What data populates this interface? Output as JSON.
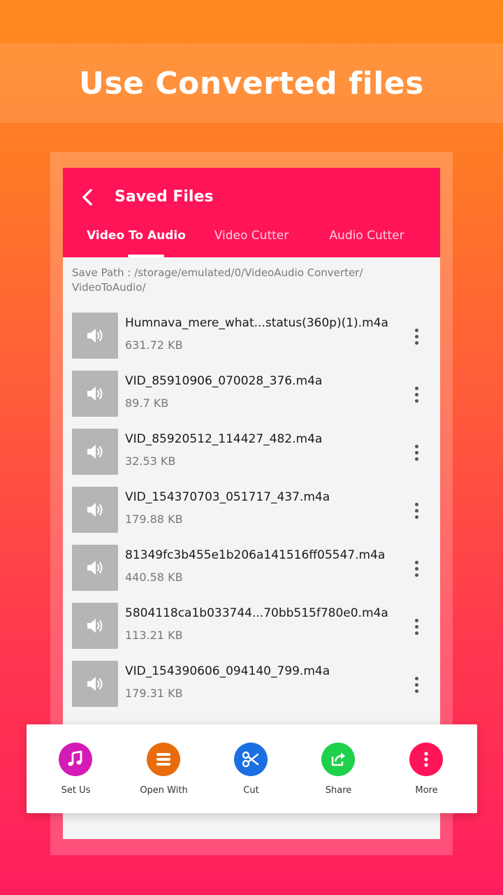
{
  "promo": {
    "title": "Use Converted files"
  },
  "header": {
    "title": "Saved Files",
    "back_icon": "back-arrow-icon"
  },
  "tabs": [
    {
      "label": "Video To Audio",
      "active": true
    },
    {
      "label": "Video Cutter",
      "active": false
    },
    {
      "label": "Audio Cutter",
      "active": false
    }
  ],
  "save_path": "Save Path : /storage/emulated/0/VideoAudio Converter/\nVideoToAudio/",
  "files": [
    {
      "name": "Humnava_mere_what...status(360p)(1).m4a",
      "size": "631.72 KB"
    },
    {
      "name": "VID_85910906_070028_376.m4a",
      "size": "89.7 KB"
    },
    {
      "name": "VID_85920512_114427_482.m4a",
      "size": "32.53 KB"
    },
    {
      "name": "VID_154370703_051717_437.m4a",
      "size": "179.88 KB"
    },
    {
      "name": "81349fc3b455e1b206a141516ff05547.m4a",
      "size": "440.58 KB"
    },
    {
      "name": "5804118ca1b033744...70bb515f780e0.m4a",
      "size": "113.21 KB"
    },
    {
      "name": "VID_154390606_094140_799.m4a",
      "size": "179.31 KB"
    }
  ],
  "actions": [
    {
      "label": "Set Us",
      "icon": "music-note-icon",
      "color": "#d41bb5"
    },
    {
      "label": "Open With",
      "icon": "list-icon",
      "color": "#e86c0c"
    },
    {
      "label": "Cut",
      "icon": "scissors-icon",
      "color": "#1a6fe3"
    },
    {
      "label": "Share",
      "icon": "share-icon",
      "color": "#1fd14a"
    },
    {
      "label": "More",
      "icon": "more-vertical-icon",
      "color": "#ff1458"
    }
  ],
  "colors": {
    "accent": "#ff1458",
    "thumb": "#b5b5b5"
  }
}
